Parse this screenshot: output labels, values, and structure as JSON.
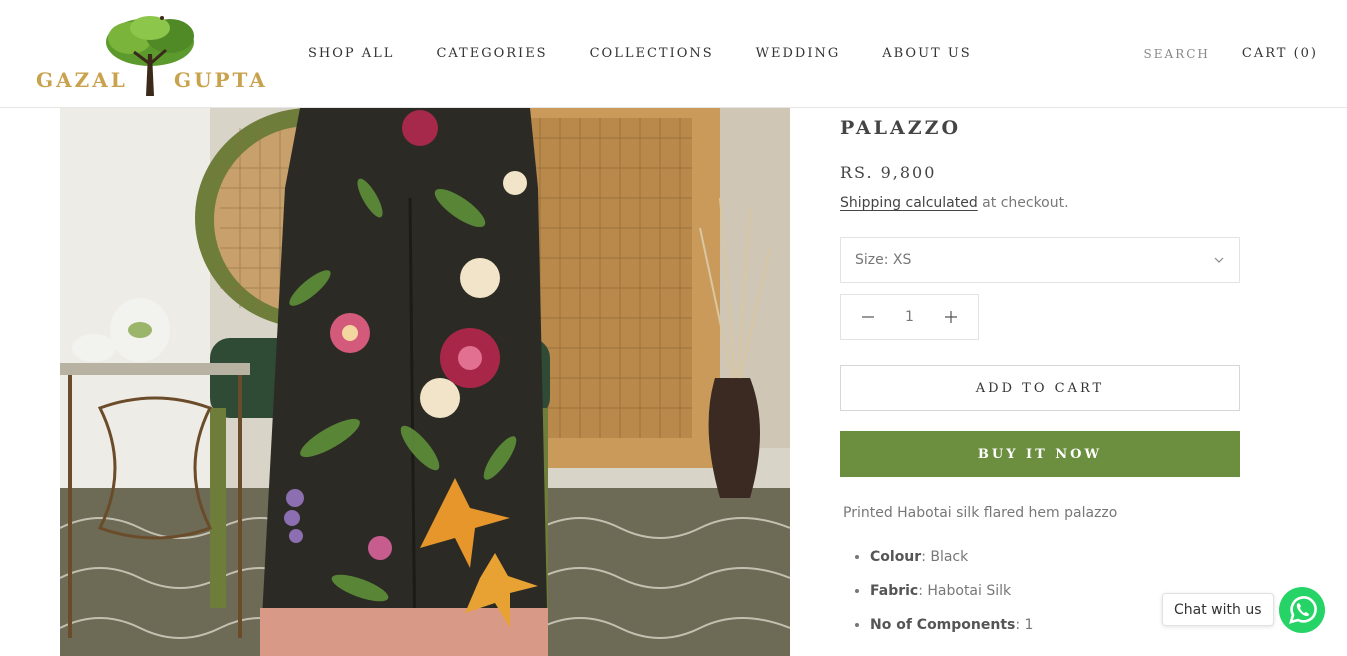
{
  "brand": {
    "name_left": "GAZAL",
    "name_right": "GUPTA",
    "logo_icon": "tree-logo-icon"
  },
  "nav": {
    "items": [
      {
        "label": "SHOP ALL"
      },
      {
        "label": "CATEGORIES"
      },
      {
        "label": "COLLECTIONS"
      },
      {
        "label": "WEDDING"
      },
      {
        "label": "ABOUT US"
      }
    ],
    "search_label": "SEARCH",
    "cart_label": "CART (0)"
  },
  "product": {
    "title": "PALAZZO",
    "price": "RS. 9,800",
    "shipping_link": "Shipping calculated",
    "shipping_rest": " at checkout.",
    "size_label": "Size: XS",
    "quantity": "1",
    "add_to_cart": "ADD TO CART",
    "buy_now": "BUY IT NOW",
    "description": "Printed Habotai silk flared hem palazzo",
    "features": [
      {
        "key": "Colour",
        "value": ": Black"
      },
      {
        "key": "Fabric",
        "value": ":  Habotai Silk"
      },
      {
        "key": "No of Components",
        "value": ": 1"
      }
    ]
  },
  "chat": {
    "label": "Chat with us",
    "icon": "whatsapp-icon"
  },
  "colors": {
    "accent_green": "#6b8f3e",
    "logo_gold": "#c9a24e",
    "whatsapp_green": "#25d366"
  }
}
